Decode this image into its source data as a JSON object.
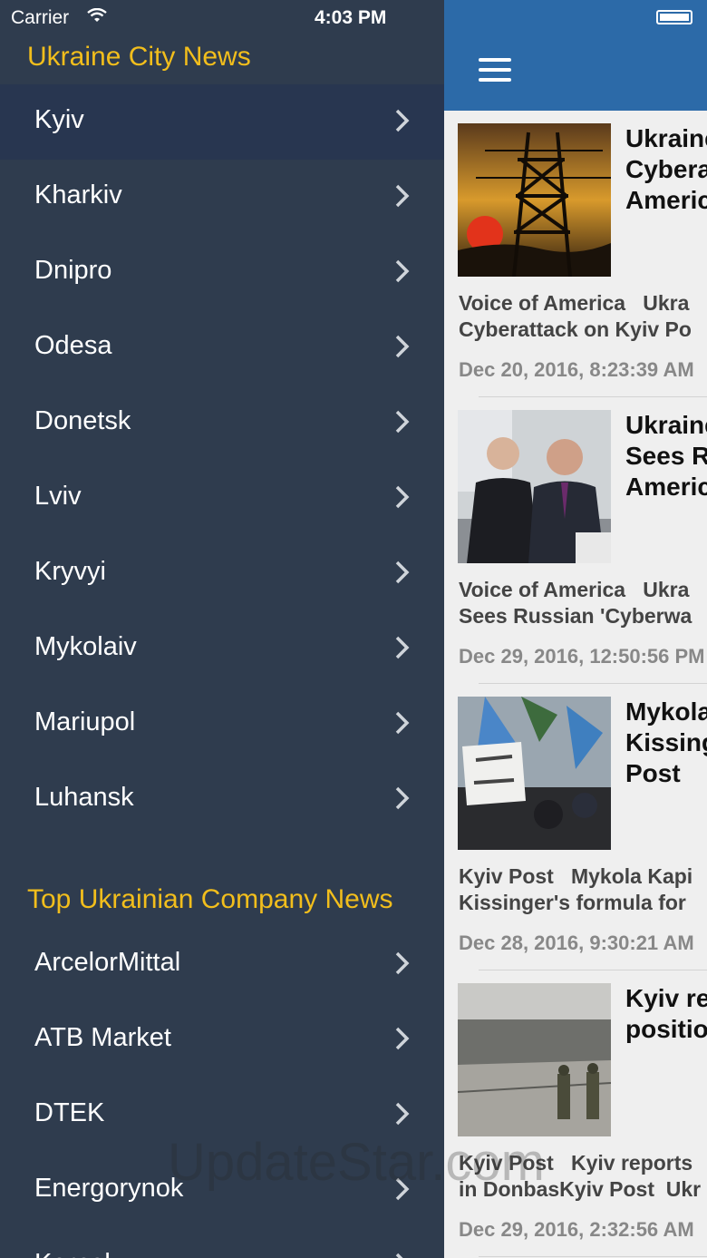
{
  "status": {
    "carrier": "Carrier",
    "time": "4:03 PM"
  },
  "city_section": {
    "title": "Ukraine City News",
    "items": [
      "Kyiv",
      "Kharkiv",
      "Dnipro",
      "Odesa",
      "Donetsk",
      "Lviv",
      "Kryvyi",
      "Mykolaiv",
      "Mariupol",
      "Luhansk"
    ]
  },
  "company_section": {
    "title": "Top Ukrainian Company News",
    "items": [
      "ArcelorMittal",
      "ATB Market",
      "DTEK",
      "Energorynok",
      "Kernel"
    ]
  },
  "articles": [
    {
      "headline": "Ukraine\nCybera\nAmeric",
      "summary": "Voice of America   Ukra\nCyberattack on Kyiv Po",
      "date": "Dec 20, 2016, 8:23:39 AM"
    },
    {
      "headline": "Ukraine\nSees R\nAmeric",
      "summary": "Voice of America   Ukra\nSees Russian 'Cyberwa",
      "date": "Dec 29, 2016, 12:50:56 PM"
    },
    {
      "headline": "Mykola\nKissing\nPost",
      "summary": "Kyiv Post   Mykola Kapi\nKissinger's formula for",
      "date": "Dec 28, 2016, 9:30:21 AM"
    },
    {
      "headline": "Kyiv re\npositio",
      "summary": "Kyiv Post   Kyiv reports\nin DonbasKyiv Post  Ukr",
      "date": "Dec 29, 2016, 2:32:56 AM"
    }
  ],
  "watermark": "UpdateStar.com",
  "colors": {
    "sidebar_bg": "#2f3c4e",
    "accent": "#f2be1c",
    "navbar": "#2c6aa8"
  }
}
